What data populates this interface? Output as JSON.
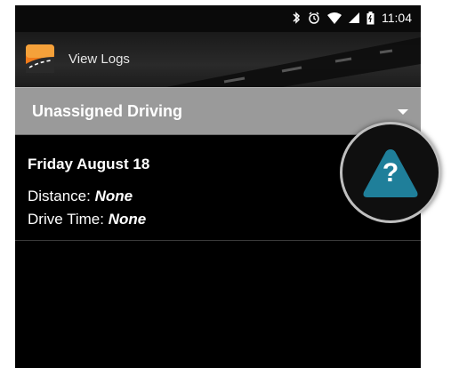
{
  "status_bar": {
    "time": "11:04",
    "icons": [
      "bluetooth-icon",
      "alarm-icon",
      "wifi-icon",
      "signal-icon",
      "battery-icon"
    ]
  },
  "app_bar": {
    "title": "View Logs",
    "logo_icon": "road-logo-icon"
  },
  "filter": {
    "selected": "Unassigned Driving",
    "icon": "dropdown-caret-icon"
  },
  "log": {
    "date": "Friday August 18",
    "distance_label": "Distance:",
    "distance_value": "None",
    "drive_time_label": "Drive Time:",
    "drive_time_value": "None"
  },
  "help": {
    "icon": "help-warning-icon",
    "glyph": "?",
    "color": "#1f7f9a"
  },
  "colors": {
    "selector_bg": "#9a9a9a",
    "screen_bg": "#000000"
  }
}
